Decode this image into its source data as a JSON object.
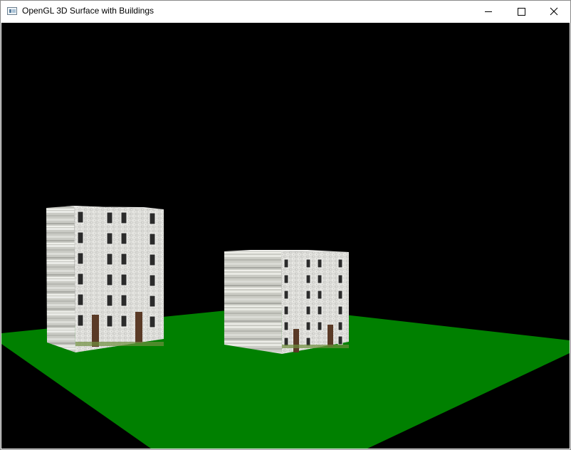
{
  "window": {
    "title": "OpenGL 3D Surface with Buildings",
    "controls": [
      "minimize",
      "maximize",
      "close"
    ]
  },
  "scene": {
    "background_color": "#000000",
    "ground_color": "#008000",
    "building_count": 2
  }
}
